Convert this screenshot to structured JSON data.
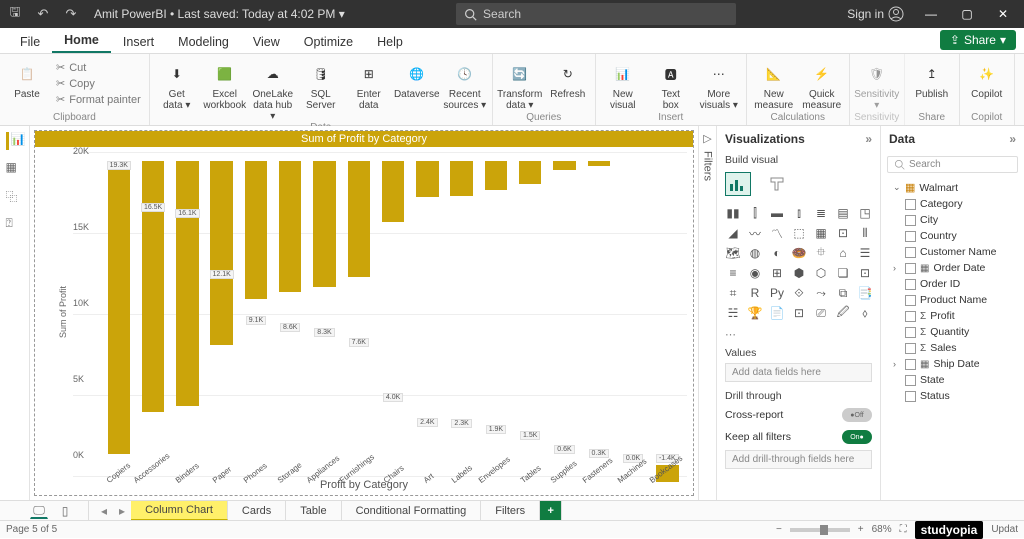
{
  "titlebar": {
    "title": "Amit PowerBI • Last saved: Today at 4:02 PM",
    "search_placeholder": "Search",
    "signin": "Sign in"
  },
  "menu": {
    "items": [
      "File",
      "Home",
      "Insert",
      "Modeling",
      "View",
      "Optimize",
      "Help"
    ],
    "active": 1,
    "share": "Share"
  },
  "ribbon": {
    "groups": [
      {
        "label": "Clipboard",
        "large": [
          {
            "l": "Paste"
          }
        ],
        "small": [
          "Cut",
          "Copy",
          "Format painter"
        ]
      },
      {
        "label": "Data",
        "large": [
          {
            "l": "Get data ▾"
          },
          {
            "l": "Excel workbook"
          },
          {
            "l": "OneLake data hub ▾"
          },
          {
            "l": "SQL Server"
          },
          {
            "l": "Enter data"
          },
          {
            "l": "Dataverse"
          },
          {
            "l": "Recent sources ▾"
          }
        ]
      },
      {
        "label": "Queries",
        "large": [
          {
            "l": "Transform data ▾"
          },
          {
            "l": "Refresh"
          }
        ]
      },
      {
        "label": "Insert",
        "large": [
          {
            "l": "New visual"
          },
          {
            "l": "Text box"
          },
          {
            "l": "More visuals ▾"
          }
        ]
      },
      {
        "label": "Calculations",
        "large": [
          {
            "l": "New measure"
          },
          {
            "l": "Quick measure"
          }
        ]
      },
      {
        "label": "Sensitivity",
        "large": [
          {
            "l": "Sensitivity ▾"
          }
        ],
        "disabled": true
      },
      {
        "label": "Share",
        "large": [
          {
            "l": "Publish"
          }
        ]
      },
      {
        "label": "Copilot",
        "large": [
          {
            "l": "Copilot"
          }
        ]
      }
    ]
  },
  "chart_data": {
    "type": "bar",
    "title": "Sum of Profit by Category",
    "ylabel": "Sum of Profit",
    "xlabel": "Profit by Category",
    "ylim": [
      0,
      20000
    ],
    "yticks": [
      "0K",
      "5K",
      "10K",
      "15K",
      "20K"
    ],
    "categories": [
      "Copiers",
      "Accessories",
      "Binders",
      "Paper",
      "Phones",
      "Storage",
      "Appliances",
      "Furnishings",
      "Chairs",
      "Art",
      "Labels",
      "Envelopes",
      "Tables",
      "Supplies",
      "Fasteners",
      "Machines",
      "Bookcases"
    ],
    "values": [
      19300,
      16500,
      16100,
      12100,
      9100,
      8600,
      8300,
      7600,
      4000,
      2400,
      2300,
      1900,
      1500,
      600,
      300,
      0,
      -1400
    ],
    "value_labels": [
      "19.3K",
      "16.5K",
      "16.1K",
      "12.1K",
      "9.1K",
      "8.6K",
      "8.3K",
      "7.6K",
      "4.0K",
      "2.4K",
      "2.3K",
      "1.9K",
      "1.5K",
      "0.6K",
      "0.3K",
      "0.0K",
      "-1.4K"
    ]
  },
  "filters_label": "Filters",
  "viz": {
    "title": "Visualizations",
    "build": "Build visual",
    "values": "Values",
    "add_data": "Add data fields here",
    "drill": "Drill through",
    "cross": "Cross-report",
    "cross_state": "Off",
    "keep": "Keep all filters",
    "keep_state": "On",
    "add_drill": "Add drill-through fields here"
  },
  "data": {
    "title": "Data",
    "search_placeholder": "Search",
    "table": "Walmart",
    "fields": [
      {
        "n": "Category"
      },
      {
        "n": "City"
      },
      {
        "n": "Country"
      },
      {
        "n": "Customer Name"
      },
      {
        "n": "Order Date",
        "exp": true,
        "date": true
      },
      {
        "n": "Order ID"
      },
      {
        "n": "Product Name"
      },
      {
        "n": "Profit",
        "sigma": true
      },
      {
        "n": "Quantity",
        "sigma": true
      },
      {
        "n": "Sales",
        "sigma": true
      },
      {
        "n": "Ship Date",
        "exp": true,
        "date": true
      },
      {
        "n": "State"
      },
      {
        "n": "Status"
      }
    ]
  },
  "pagetabs": [
    "Column Chart",
    "Cards",
    "Table",
    "Conditional Formatting",
    "Filters"
  ],
  "pagetabs_active": 0,
  "status": {
    "page": "Page 5 of 5",
    "zoom": "68%",
    "update": "Updat"
  },
  "brand": "studyopia"
}
